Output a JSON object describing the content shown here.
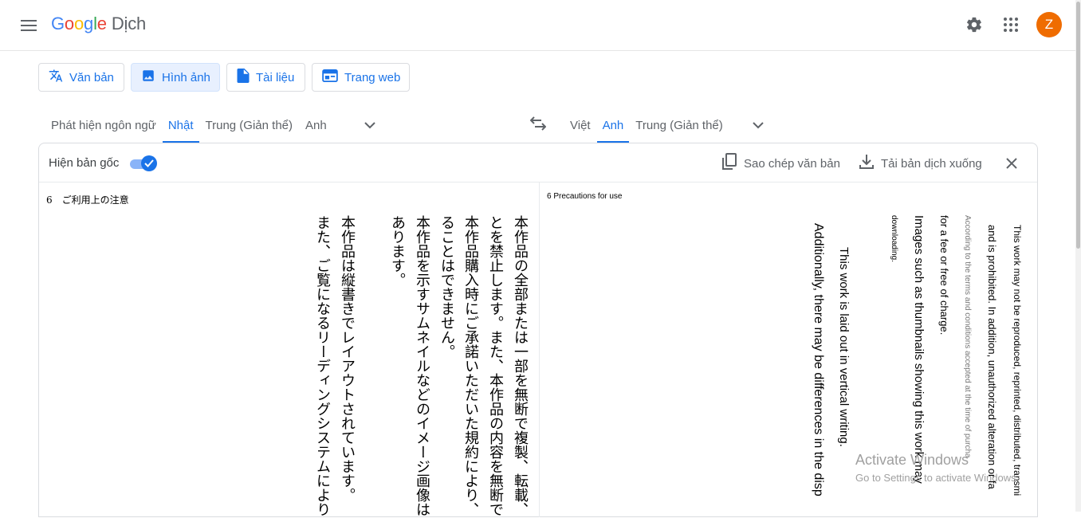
{
  "header": {
    "logo_letters": [
      "G",
      "o",
      "o",
      "g",
      "l",
      "e"
    ],
    "product": "Dịch",
    "avatar_letter": "Z"
  },
  "modes": [
    {
      "label": "Văn bản",
      "icon": "translate-icon"
    },
    {
      "label": "Hình ảnh",
      "icon": "image-icon",
      "active": true
    },
    {
      "label": "Tài liệu",
      "icon": "document-icon"
    },
    {
      "label": "Trang web",
      "icon": "website-icon"
    }
  ],
  "source_langs": [
    "Phát hiện ngôn ngữ",
    "Nhật",
    "Trung (Giản thể)",
    "Anh"
  ],
  "target_langs": [
    "Việt",
    "Anh",
    "Trung (Giản thể)"
  ],
  "panel": {
    "show_original_label": "Hiện bản gốc",
    "copy_label": "Sao chép văn bản",
    "download_label": "Tải bản dịch xuống"
  },
  "original": {
    "heading": "6　ご利用上の注意",
    "columns": [
      "本作品の全部または一部を無断で複製、転載、",
      "とを禁止します。また、本作品の内容を無断で",
      "本作品購入時にご承諾いただいた規約により、",
      "ることはできません。",
      "本作品を示すサムネイルなどのイメージ画像は",
      "あります。",
      "本作品は縦書きでレイアウトされています。",
      "また、ご覧になるリーディングシステムにより"
    ]
  },
  "translated": {
    "heading": "6 Precautions for use",
    "columns": [
      "This work may not be reproduced, reprinted, distributed, transmi",
      "and is prohibited. In addition, unauthorized alteration or fa",
      "According to the terms and conditions accepted at the time of purcha",
      "for a fee or free of charge.",
      "Images such as thumbnails showing this work may",
      "downloading.",
      "This work is laid out in vertical writing.",
      "Additionally, there may be differences in the disp"
    ]
  },
  "watermark": {
    "line1": "Activate Windows",
    "line2": "Go to Settings to activate Windows."
  }
}
